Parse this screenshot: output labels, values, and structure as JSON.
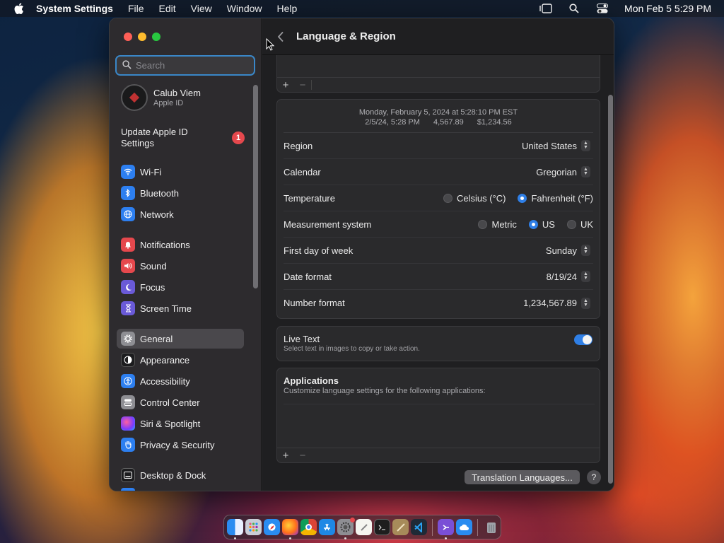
{
  "menubar": {
    "app_name": "System Settings",
    "menus": [
      "File",
      "Edit",
      "View",
      "Window",
      "Help"
    ],
    "datetime": "Mon Feb 5  5:29 PM",
    "icons": [
      "stage-manager-icon",
      "spotlight-search-icon",
      "control-center-icon"
    ]
  },
  "sidebar": {
    "search_placeholder": "Search",
    "profile": {
      "name": "Calub Viem",
      "subtitle": "Apple ID"
    },
    "update": {
      "label": "Update Apple ID Settings",
      "badge": "1"
    },
    "items": [
      {
        "label": "Wi-Fi",
        "icon": "wifi-icon",
        "color": "#2d7ff0"
      },
      {
        "label": "Bluetooth",
        "icon": "bluetooth-icon",
        "color": "#2d7ff0"
      },
      {
        "label": "Network",
        "icon": "network-globe-icon",
        "color": "#2d7ff0"
      },
      {
        "label": "Notifications",
        "icon": "notifications-bell-icon",
        "color": "#e5484d"
      },
      {
        "label": "Sound",
        "icon": "sound-speaker-icon",
        "color": "#e5484d"
      },
      {
        "label": "Focus",
        "icon": "focus-moon-icon",
        "color": "#6a5ad8"
      },
      {
        "label": "Screen Time",
        "icon": "screen-time-hourglass-icon",
        "color": "#6a5ad8"
      },
      {
        "label": "General",
        "icon": "general-gear-icon",
        "color": "#8e8e93"
      },
      {
        "label": "Appearance",
        "icon": "appearance-icon",
        "color": "#1c1c1e"
      },
      {
        "label": "Accessibility",
        "icon": "accessibility-icon",
        "color": "#2d7ff0"
      },
      {
        "label": "Control Center",
        "icon": "control-center-icon",
        "color": "#8e8e93"
      },
      {
        "label": "Siri & Spotlight",
        "icon": "siri-icon",
        "color": "#b04fd0"
      },
      {
        "label": "Privacy & Security",
        "icon": "privacy-hand-icon",
        "color": "#2d7ff0"
      },
      {
        "label": "Desktop & Dock",
        "icon": "desktop-dock-icon",
        "color": "#1c1c1e"
      }
    ],
    "selected": "General"
  },
  "content": {
    "title": "Language & Region",
    "preview": {
      "line1": "Monday, February 5, 2024 at 5:28:10 PM EST",
      "date": "2/5/24, 5:28 PM",
      "number": "4,567.89",
      "currency": "$1,234.56"
    },
    "region": {
      "label": "Region",
      "value": "United States"
    },
    "calendar": {
      "label": "Calendar",
      "value": "Gregorian"
    },
    "temperature": {
      "label": "Temperature",
      "options": [
        "Celsius (°C)",
        "Fahrenheit (°F)"
      ],
      "selected": "Fahrenheit (°F)"
    },
    "measurement": {
      "label": "Measurement system",
      "options": [
        "Metric",
        "US",
        "UK"
      ],
      "selected": "US"
    },
    "first_day": {
      "label": "First day of week",
      "value": "Sunday"
    },
    "date_format": {
      "label": "Date format",
      "value": "8/19/24"
    },
    "number_format": {
      "label": "Number format",
      "value": "1,234,567.89"
    },
    "live_text": {
      "title": "Live Text",
      "subtitle": "Select text in images to copy or take action.",
      "enabled": true
    },
    "applications": {
      "title": "Applications",
      "subtitle": "Customize language settings for the following applications:"
    },
    "add_label": "+",
    "remove_label": "−",
    "translation_button": "Translation Languages...",
    "help_label": "?"
  },
  "dock": {
    "apps": [
      "Finder",
      "Launchpad",
      "Safari",
      "Firefox",
      "Chrome",
      "App Store",
      "System Settings",
      "TextEdit",
      "Terminal",
      "Script Editor",
      "VS Code",
      "Visual Studio",
      "Cloud",
      "Trash"
    ]
  }
}
